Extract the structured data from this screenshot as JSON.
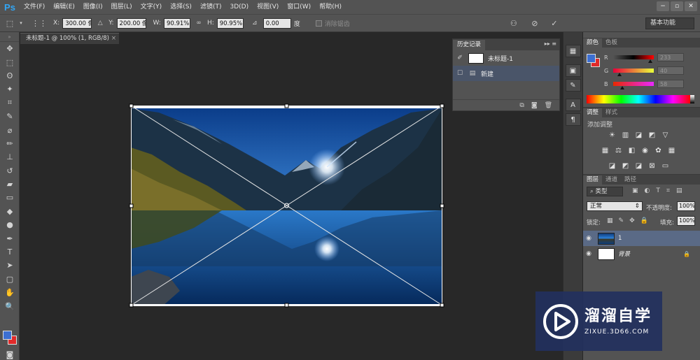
{
  "menubar": {
    "logo": "Ps",
    "items": [
      "文件(F)",
      "编辑(E)",
      "图像(I)",
      "图层(L)",
      "文字(Y)",
      "选择(S)",
      "滤镜(T)",
      "3D(D)",
      "视图(V)",
      "窗口(W)",
      "帮助(H)"
    ],
    "window_controls": [
      "−",
      "▫",
      "✕"
    ]
  },
  "options": {
    "x_label": "X:",
    "x_value": "300.00 像",
    "y_label": "Y:",
    "y_value": "200.00 像",
    "w_label": "W:",
    "w_value": "90.91%",
    "h_label": "H:",
    "h_value": "90.95%",
    "angle_value": "0.00",
    "angle_unit": "度",
    "antialias_label": "消除锯齿",
    "workspace": "基本功能"
  },
  "document": {
    "tab_title": "未标题-1 @ 100% (1, RGB/8)",
    "close": "×"
  },
  "history": {
    "tabs": [
      "历史记录"
    ],
    "snapshot_name": "未标题-1",
    "items": [
      "新建"
    ]
  },
  "color_panel": {
    "tabs": [
      "颜色",
      "色板"
    ],
    "channels": [
      {
        "label": "R",
        "value": "233",
        "level": 0.91
      },
      {
        "label": "G",
        "value": "40",
        "level": 0.16
      },
      {
        "label": "B",
        "value": "58",
        "level": 0.23
      }
    ],
    "foreground": "#3c6fd2",
    "background": "#e02a2a"
  },
  "adjustments": {
    "tabs": [
      "调整",
      "样式"
    ],
    "title": "添加调整"
  },
  "layers": {
    "tabs": [
      "图层",
      "通道",
      "路径"
    ],
    "filter_label": "类型",
    "blend_mode": "正常",
    "opacity_label": "不透明度:",
    "opacity_value": "100%",
    "lock_label": "锁定:",
    "fill_label": "填充:",
    "fill_value": "100%",
    "items": [
      {
        "name": "1",
        "selected": true
      },
      {
        "name": "背景",
        "selected": false
      }
    ]
  },
  "watermark": {
    "title": "溜溜自学",
    "url": "ZIXUE.3D66.COM"
  }
}
